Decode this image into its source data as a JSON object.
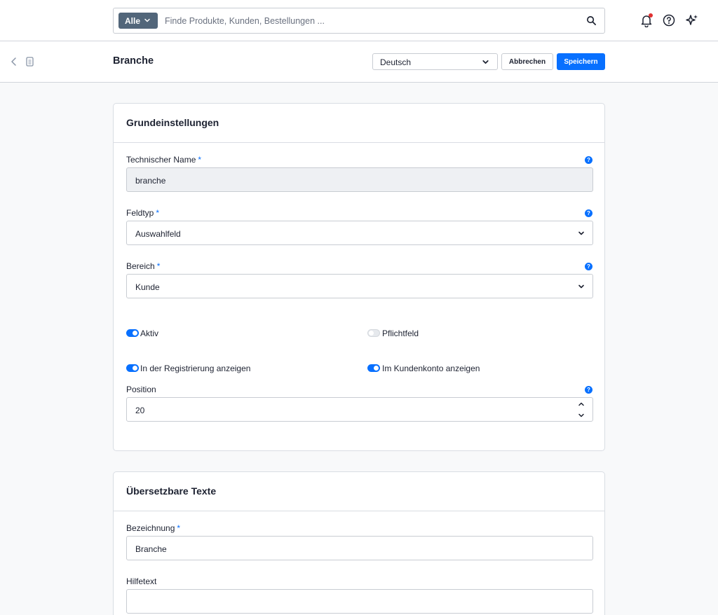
{
  "search": {
    "scope_label": "Alle",
    "placeholder": "Finde Produkte, Kunden, Bestellungen ..."
  },
  "header": {
    "title": "Branche",
    "language": "Deutsch",
    "cancel_label": "Abbrechen",
    "save_label": "Speichern"
  },
  "basic_settings": {
    "title": "Grundeinstellungen",
    "technical_name": {
      "label": "Technischer Name",
      "required": "*",
      "value": "branche"
    },
    "field_type": {
      "label": "Feldtyp",
      "required": "*",
      "value": "Auswahlfeld"
    },
    "area": {
      "label": "Bereich",
      "required": "*",
      "value": "Kunde"
    },
    "toggles": [
      {
        "label": "Aktiv",
        "on": true
      },
      {
        "label": "Pflichtfeld",
        "on": false
      },
      {
        "label": "In der Registrierung anzeigen",
        "on": true
      },
      {
        "label": "Im Kundenkonto anzeigen",
        "on": true
      }
    ],
    "position": {
      "label": "Position",
      "value": "20"
    }
  },
  "translatable_texts": {
    "title": "Übersetzbare Texte",
    "designation": {
      "label": "Bezeichnung",
      "required": "*",
      "value": "Branche"
    },
    "help_text": {
      "label": "Hilfetext",
      "value": ""
    }
  },
  "help_glyph": "?",
  "colors": {
    "primary": "#0870ff",
    "scope_button": "#52667a",
    "notification_dot": "#e03131",
    "disabled_input": "#eef0f3"
  }
}
